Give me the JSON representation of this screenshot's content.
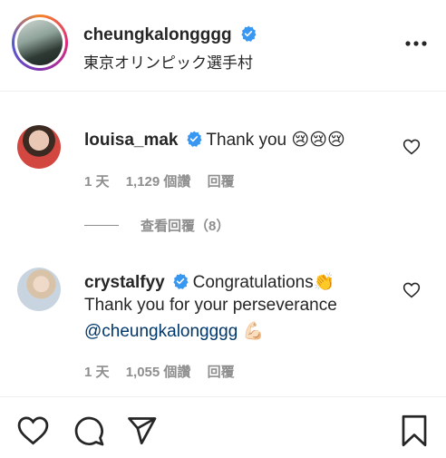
{
  "post": {
    "username": "cheungkalongggg",
    "location": "東京オリンピック選手村"
  },
  "comments": [
    {
      "username": "louisa_mak",
      "text": "Thank you 😢😢😢",
      "meta": {
        "time": "1 天",
        "likes": "1,129 個讚",
        "reply": "回覆"
      },
      "view_replies": "查看回覆（8）"
    },
    {
      "username": "crystalfyy",
      "text_line1": "Congratulations👏",
      "text_line2": "Thank you for your perseverance",
      "mention": "@cheungkalongggg",
      "emoji": "💪🏻",
      "meta": {
        "time": "1 天",
        "likes": "1,055 個讚",
        "reply": "回覆"
      }
    }
  ],
  "colors": {
    "verified": "#3897f0",
    "text": "#262626",
    "muted": "#8e8e8e",
    "link": "#00376b"
  },
  "icons": [
    "more-options-icon",
    "heart-icon",
    "comment-icon",
    "share-icon",
    "bookmark-icon",
    "verified-icon"
  ]
}
